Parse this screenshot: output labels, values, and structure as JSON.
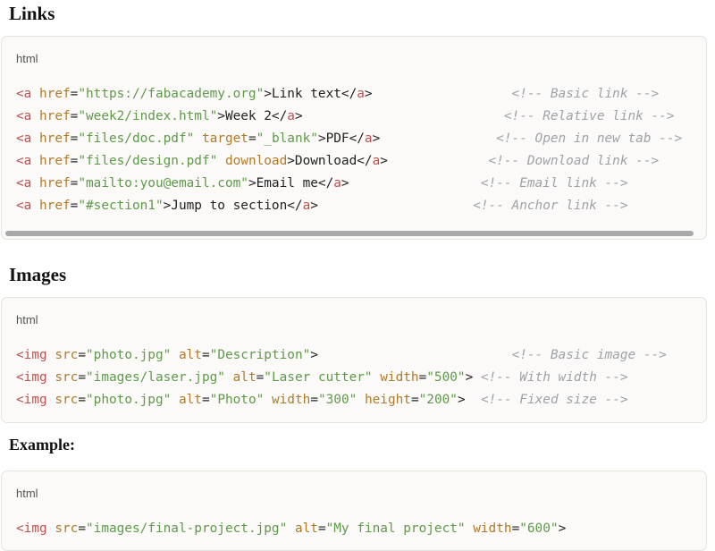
{
  "sections": {
    "links_title": "Links",
    "images_title": "Images",
    "example_title": "Example:"
  },
  "blocks": {
    "links": {
      "lang": "html",
      "lines": [
        [
          {
            "t": "tag",
            "v": "<a"
          },
          {
            "t": "txt",
            "v": " "
          },
          {
            "t": "attr",
            "v": "href"
          },
          {
            "t": "txt",
            "v": "="
          },
          {
            "t": "str",
            "v": "\"https://fabacademy.org\""
          },
          {
            "t": "txt",
            "v": ">Link text</"
          },
          {
            "t": "tag",
            "v": "a"
          },
          {
            "t": "txt",
            "v": ">                  "
          },
          {
            "t": "cmt",
            "v": "<!-- Basic link -->"
          }
        ],
        [
          {
            "t": "tag",
            "v": "<a"
          },
          {
            "t": "txt",
            "v": " "
          },
          {
            "t": "attr",
            "v": "href"
          },
          {
            "t": "txt",
            "v": "="
          },
          {
            "t": "str",
            "v": "\"week2/index.html\""
          },
          {
            "t": "txt",
            "v": ">Week 2</"
          },
          {
            "t": "tag",
            "v": "a"
          },
          {
            "t": "txt",
            "v": ">                          "
          },
          {
            "t": "cmt",
            "v": "<!-- Relative link -->"
          }
        ],
        [
          {
            "t": "tag",
            "v": "<a"
          },
          {
            "t": "txt",
            "v": " "
          },
          {
            "t": "attr",
            "v": "href"
          },
          {
            "t": "txt",
            "v": "="
          },
          {
            "t": "str",
            "v": "\"files/doc.pdf\""
          },
          {
            "t": "txt",
            "v": " "
          },
          {
            "t": "attr",
            "v": "target"
          },
          {
            "t": "txt",
            "v": "="
          },
          {
            "t": "str",
            "v": "\"_blank\""
          },
          {
            "t": "txt",
            "v": ">PDF</"
          },
          {
            "t": "tag",
            "v": "a"
          },
          {
            "t": "txt",
            "v": ">               "
          },
          {
            "t": "cmt",
            "v": "<!-- Open in new tab -->"
          }
        ],
        [
          {
            "t": "tag",
            "v": "<a"
          },
          {
            "t": "txt",
            "v": " "
          },
          {
            "t": "attr",
            "v": "href"
          },
          {
            "t": "txt",
            "v": "="
          },
          {
            "t": "str",
            "v": "\"files/design.pdf\""
          },
          {
            "t": "txt",
            "v": " "
          },
          {
            "t": "attr",
            "v": "download"
          },
          {
            "t": "txt",
            "v": ">Download</"
          },
          {
            "t": "tag",
            "v": "a"
          },
          {
            "t": "txt",
            "v": ">             "
          },
          {
            "t": "cmt",
            "v": "<!-- Download link -->"
          }
        ],
        [
          {
            "t": "tag",
            "v": "<a"
          },
          {
            "t": "txt",
            "v": " "
          },
          {
            "t": "attr",
            "v": "href"
          },
          {
            "t": "txt",
            "v": "="
          },
          {
            "t": "str",
            "v": "\"mailto:you@email.com\""
          },
          {
            "t": "txt",
            "v": ">Email me</"
          },
          {
            "t": "tag",
            "v": "a"
          },
          {
            "t": "txt",
            "v": ">                 "
          },
          {
            "t": "cmt",
            "v": "<!-- Email link -->"
          }
        ],
        [
          {
            "t": "tag",
            "v": "<a"
          },
          {
            "t": "txt",
            "v": " "
          },
          {
            "t": "attr",
            "v": "href"
          },
          {
            "t": "txt",
            "v": "="
          },
          {
            "t": "str",
            "v": "\"#section1\""
          },
          {
            "t": "txt",
            "v": ">Jump to section</"
          },
          {
            "t": "tag",
            "v": "a"
          },
          {
            "t": "txt",
            "v": ">                    "
          },
          {
            "t": "cmt",
            "v": "<!-- Anchor link -->"
          }
        ]
      ]
    },
    "images": {
      "lang": "html",
      "lines": [
        [
          {
            "t": "tag",
            "v": "<img"
          },
          {
            "t": "txt",
            "v": " "
          },
          {
            "t": "attr",
            "v": "src"
          },
          {
            "t": "txt",
            "v": "="
          },
          {
            "t": "str",
            "v": "\"photo.jpg\""
          },
          {
            "t": "txt",
            "v": " "
          },
          {
            "t": "attr",
            "v": "alt"
          },
          {
            "t": "txt",
            "v": "="
          },
          {
            "t": "str",
            "v": "\"Description\""
          },
          {
            "t": "txt",
            "v": ">                         "
          },
          {
            "t": "cmt",
            "v": "<!-- Basic image -->"
          }
        ],
        [
          {
            "t": "tag",
            "v": "<img"
          },
          {
            "t": "txt",
            "v": " "
          },
          {
            "t": "attr",
            "v": "src"
          },
          {
            "t": "txt",
            "v": "="
          },
          {
            "t": "str",
            "v": "\"images/laser.jpg\""
          },
          {
            "t": "txt",
            "v": " "
          },
          {
            "t": "attr",
            "v": "alt"
          },
          {
            "t": "txt",
            "v": "="
          },
          {
            "t": "str",
            "v": "\"Laser cutter\""
          },
          {
            "t": "txt",
            "v": " "
          },
          {
            "t": "attr",
            "v": "width"
          },
          {
            "t": "txt",
            "v": "="
          },
          {
            "t": "str",
            "v": "\"500\""
          },
          {
            "t": "txt",
            "v": "> "
          },
          {
            "t": "cmt",
            "v": "<!-- With width -->"
          }
        ],
        [
          {
            "t": "tag",
            "v": "<img"
          },
          {
            "t": "txt",
            "v": " "
          },
          {
            "t": "attr",
            "v": "src"
          },
          {
            "t": "txt",
            "v": "="
          },
          {
            "t": "str",
            "v": "\"photo.jpg\""
          },
          {
            "t": "txt",
            "v": " "
          },
          {
            "t": "attr",
            "v": "alt"
          },
          {
            "t": "txt",
            "v": "="
          },
          {
            "t": "str",
            "v": "\"Photo\""
          },
          {
            "t": "txt",
            "v": " "
          },
          {
            "t": "attr",
            "v": "width"
          },
          {
            "t": "txt",
            "v": "="
          },
          {
            "t": "str",
            "v": "\"300\""
          },
          {
            "t": "txt",
            "v": " "
          },
          {
            "t": "attr",
            "v": "height"
          },
          {
            "t": "txt",
            "v": "="
          },
          {
            "t": "str",
            "v": "\"200\""
          },
          {
            "t": "txt",
            "v": ">  "
          },
          {
            "t": "cmt",
            "v": "<!-- Fixed size -->"
          }
        ]
      ]
    },
    "example": {
      "lang": "html",
      "lines": [
        [
          {
            "t": "tag",
            "v": "<img"
          },
          {
            "t": "txt",
            "v": " "
          },
          {
            "t": "attr",
            "v": "src"
          },
          {
            "t": "txt",
            "v": "="
          },
          {
            "t": "str",
            "v": "\"images/final-project.jpg\""
          },
          {
            "t": "txt",
            "v": " "
          },
          {
            "t": "attr",
            "v": "alt"
          },
          {
            "t": "txt",
            "v": "="
          },
          {
            "t": "str",
            "v": "\"My final project\""
          },
          {
            "t": "txt",
            "v": " "
          },
          {
            "t": "attr",
            "v": "width"
          },
          {
            "t": "txt",
            "v": "="
          },
          {
            "t": "str",
            "v": "\"600\""
          },
          {
            "t": "txt",
            "v": ">"
          }
        ]
      ]
    }
  },
  "colors": {
    "tag": "#c0504d",
    "attr": "#b07a2a",
    "string": "#5e9a4a",
    "comment": "#9ea2a8",
    "block_bg": "#fbfaf8"
  }
}
